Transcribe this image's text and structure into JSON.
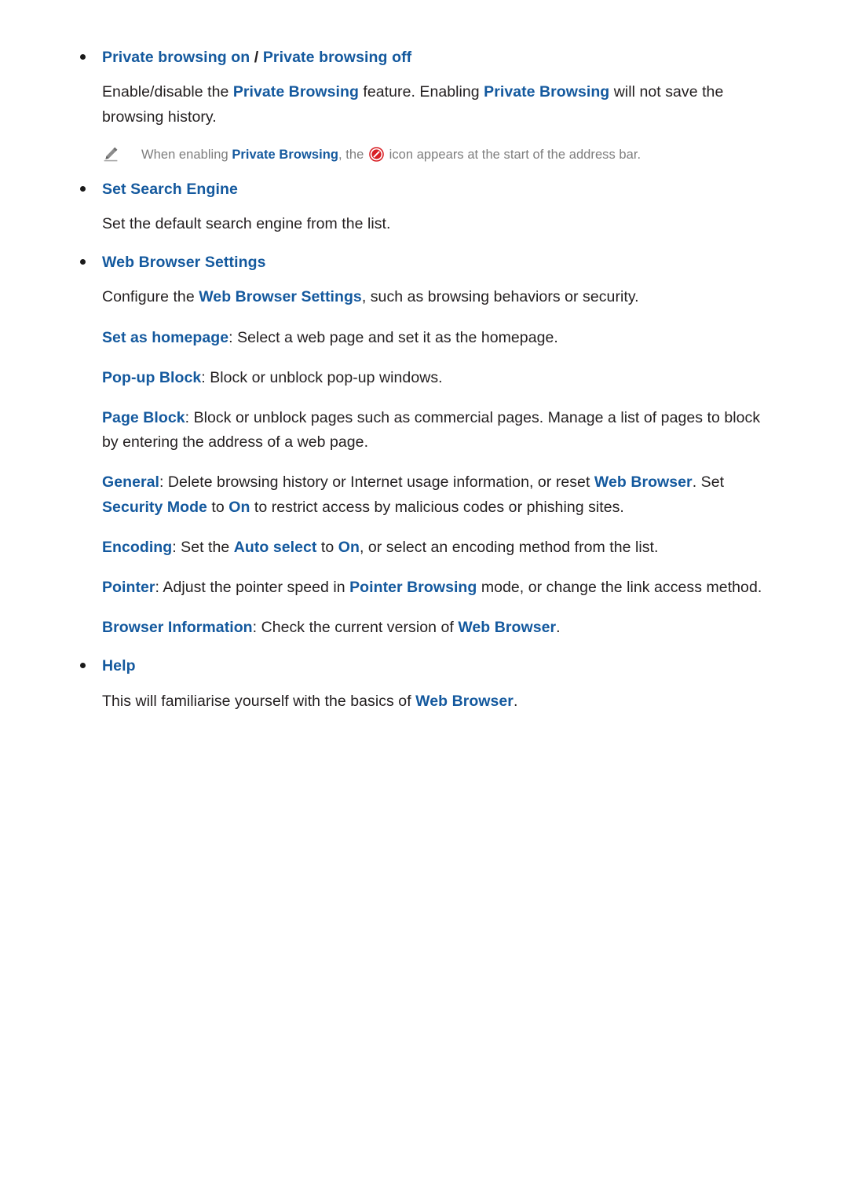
{
  "page": {
    "background": "#ffffff",
    "accent_blue": "#14599e",
    "body_text_color": "#231f20",
    "note_text_color": "#7d7d7d",
    "icon_red": "#d81e24"
  },
  "sections": [
    {
      "id": "private-browsing",
      "bullet_title_parts": [
        {
          "text": "Private browsing on",
          "style": "blue"
        },
        {
          "text": " / ",
          "style": "black"
        },
        {
          "text": "Private browsing off",
          "style": "blue"
        }
      ],
      "body": [
        {
          "parts": [
            {
              "text": "Enable/disable the ",
              "style": "black"
            },
            {
              "text": "Private Browsing",
              "style": "blue"
            },
            {
              "text": " feature. Enabling ",
              "style": "black"
            },
            {
              "text": "Private Browsing",
              "style": "blue"
            },
            {
              "text": " will not save the browsing history.",
              "style": "black"
            }
          ]
        }
      ],
      "note": {
        "icon": "pencil-icon",
        "parts": [
          {
            "text": "When enabling ",
            "style": "gray"
          },
          {
            "text": "Private Browsing",
            "style": "blue"
          },
          {
            "text": ", the ",
            "style": "gray"
          },
          {
            "text": "",
            "style": "icon",
            "icon": "private-browsing-icon"
          },
          {
            "text": " icon appears at the start of the address bar.",
            "style": "gray"
          }
        ]
      }
    },
    {
      "id": "set-search-engine",
      "bullet_title_parts": [
        {
          "text": "Set Search Engine",
          "style": "blue"
        }
      ],
      "body": [
        {
          "parts": [
            {
              "text": "Set the default search engine from the list.",
              "style": "black"
            }
          ]
        }
      ]
    },
    {
      "id": "web-browser-settings",
      "bullet_title_parts": [
        {
          "text": "Web Browser Settings",
          "style": "blue"
        }
      ],
      "body": [
        {
          "parts": [
            {
              "text": "Configure the ",
              "style": "black"
            },
            {
              "text": "Web Browser Settings",
              "style": "blue"
            },
            {
              "text": ", such as browsing behaviors or security.",
              "style": "black"
            }
          ]
        },
        {
          "parts": [
            {
              "text": "Set as homepage",
              "style": "blue"
            },
            {
              "text": ": Select a web page and set it as the homepage.",
              "style": "black"
            }
          ]
        },
        {
          "parts": [
            {
              "text": "Pop-up Block",
              "style": "blue"
            },
            {
              "text": ": Block or unblock pop-up windows.",
              "style": "black"
            }
          ]
        },
        {
          "parts": [
            {
              "text": "Page Block",
              "style": "blue"
            },
            {
              "text": ": Block or unblock pages such as commercial pages. Manage a list of pages to block by entering the address of a web page.",
              "style": "black"
            }
          ]
        },
        {
          "parts": [
            {
              "text": "General",
              "style": "blue"
            },
            {
              "text": ": Delete browsing history or Internet usage information, or reset ",
              "style": "black"
            },
            {
              "text": "Web Browser",
              "style": "blue"
            },
            {
              "text": ". Set ",
              "style": "black"
            },
            {
              "text": "Security Mode",
              "style": "blue"
            },
            {
              "text": " to ",
              "style": "black"
            },
            {
              "text": "On",
              "style": "blue"
            },
            {
              "text": " to restrict access by malicious codes or phishing sites.",
              "style": "black"
            }
          ]
        },
        {
          "parts": [
            {
              "text": "Encoding",
              "style": "blue"
            },
            {
              "text": ": Set the ",
              "style": "black"
            },
            {
              "text": "Auto select",
              "style": "blue"
            },
            {
              "text": " to ",
              "style": "black"
            },
            {
              "text": "On",
              "style": "blue"
            },
            {
              "text": ", or select an encoding method from the list.",
              "style": "black"
            }
          ]
        },
        {
          "parts": [
            {
              "text": "Pointer",
              "style": "blue"
            },
            {
              "text": ": Adjust the pointer speed in ",
              "style": "black"
            },
            {
              "text": "Pointer Browsing",
              "style": "blue"
            },
            {
              "text": " mode, or change the link access method.",
              "style": "black"
            }
          ]
        },
        {
          "parts": [
            {
              "text": "Browser Information",
              "style": "blue"
            },
            {
              "text": ": Check the current version of ",
              "style": "black"
            },
            {
              "text": "Web Browser",
              "style": "blue"
            },
            {
              "text": ".",
              "style": "black"
            }
          ]
        }
      ]
    },
    {
      "id": "help",
      "bullet_title_parts": [
        {
          "text": "Help",
          "style": "blue"
        }
      ],
      "body": [
        {
          "parts": [
            {
              "text": "This will familiarise yourself with the basics of ",
              "style": "black"
            },
            {
              "text": "Web Browser",
              "style": "blue"
            },
            {
              "text": ".",
              "style": "black"
            }
          ]
        }
      ]
    }
  ]
}
